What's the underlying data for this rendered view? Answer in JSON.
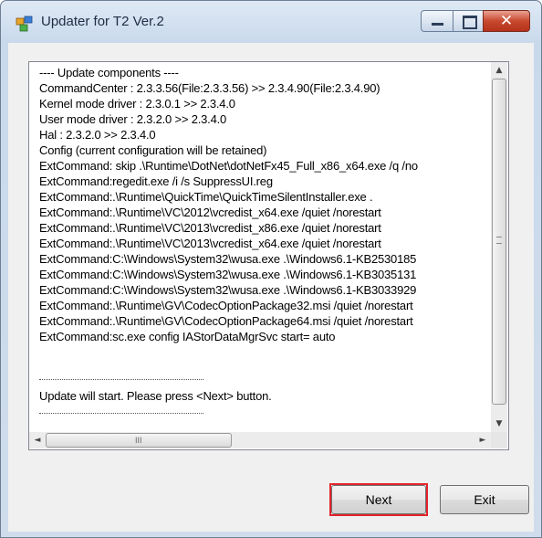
{
  "window": {
    "title": "Updater for T2 Ver.2",
    "icons": {
      "app": "updater-app-icon",
      "minimize": "minimize-icon",
      "maximize": "maximize-icon",
      "close": "close-icon"
    },
    "close_symbol": "✕"
  },
  "log": {
    "lines": [
      "---- Update components ----",
      "CommandCenter : 2.3.3.56(File:2.3.3.56) >> 2.3.4.90(File:2.3.4.90)",
      "Kernel mode driver : 2.3.0.1 >> 2.3.4.0",
      "User mode driver : 2.3.2.0 >> 2.3.4.0",
      "Hal : 2.3.2.0 >> 2.3.4.0",
      "Config (current configuration will be retained)",
      "ExtCommand: skip .\\Runtime\\DotNet\\dotNetFx45_Full_x86_x64.exe /q /no",
      "ExtCommand:regedit.exe /i /s SuppressUI.reg",
      "ExtCommand:.\\Runtime\\QuickTime\\QuickTimeSilentInstaller.exe .",
      "ExtCommand:.\\Runtime\\VC\\2012\\vcredist_x64.exe /quiet /norestart",
      "ExtCommand:.\\Runtime\\VC\\2013\\vcredist_x86.exe /quiet /norestart",
      "ExtCommand:.\\Runtime\\VC\\2013\\vcredist_x64.exe /quiet /norestart",
      "ExtCommand:C:\\Windows\\System32\\wusa.exe .\\Windows6.1-KB2530185",
      "ExtCommand:C:\\Windows\\System32\\wusa.exe .\\Windows6.1-KB3035131",
      "ExtCommand:C:\\Windows\\System32\\wusa.exe .\\Windows6.1-KB3033929",
      "ExtCommand:.\\Runtime\\GV\\CodecOptionPackage32.msi /quiet /norestart",
      "ExtCommand:.\\Runtime\\GV\\CodecOptionPackage64.msi /quiet /norestart",
      "ExtCommand:sc.exe config IAStorDataMgrSvc start= auto"
    ],
    "message": "Update will start. Please press <Next> button."
  },
  "scrollbars": {
    "vertical": {
      "up_symbol": "▲",
      "down_symbol": "▼",
      "position_fraction": 0.0
    },
    "horizontal": {
      "left_symbol": "◄",
      "right_symbol": "►",
      "grip": "III",
      "position_fraction": 0.0
    }
  },
  "buttons": {
    "next": "Next",
    "exit": "Exit"
  },
  "colors": {
    "focus_highlight": "#e3242b"
  }
}
